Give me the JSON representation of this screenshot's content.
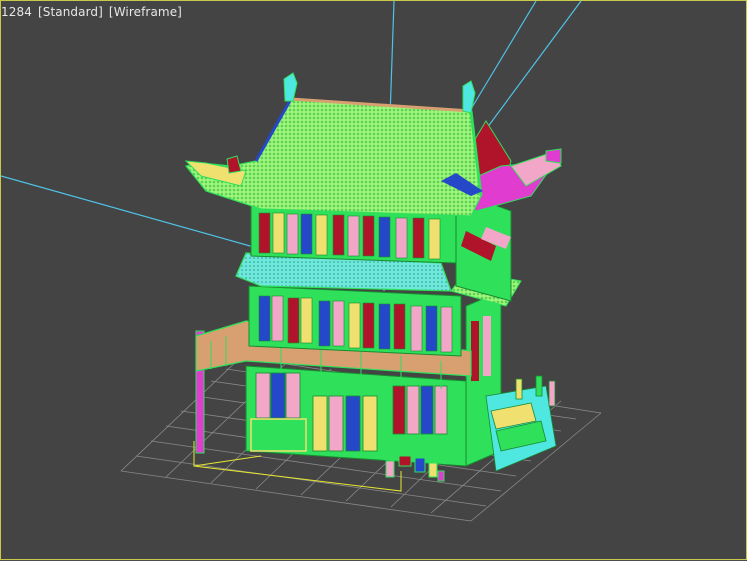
{
  "viewport": {
    "label_parts": [
      "1284",
      "[Standard]",
      "[Wireframe]"
    ],
    "object_label": "Chinese pagoda building (wireframe)"
  },
  "colors": {
    "background": "#444444",
    "active_border": "#c8c84a",
    "grid_line": "#8a8a8a",
    "camera_line": "#4fc3e6",
    "roof_green": "#8ef26e",
    "wire_green": "#2ee05a",
    "wall_red": "#b0142a",
    "wall_blue": "#2548c8",
    "wall_pink": "#f2a6c8",
    "wall_yellow": "#f0e070",
    "wall_cyan": "#4ee8e0",
    "magenta": "#e03cd0"
  }
}
